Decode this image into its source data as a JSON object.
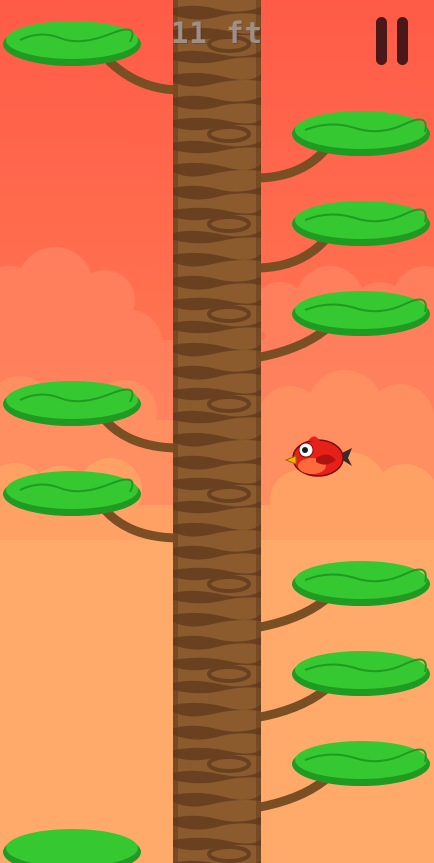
{
  "hud": {
    "score_text": "11 ft",
    "pause_icon": "pause-icon"
  },
  "colors": {
    "sky_top": "#ff5c48",
    "sky_bottom": "#ffa766",
    "cloud_back": "#ff7a5a",
    "cloud_front": "#ff9a64",
    "trunk": "#8a5a2c",
    "trunk_stripe": "#6b4220",
    "foliage": "#35c831",
    "foliage_dark": "#1f9a22",
    "branch": "#7b4f24",
    "bird_body": "#e8201a",
    "bird_beak": "#ffb400",
    "pause": "#4a1818"
  },
  "scene": {
    "branch_sides": [
      "left",
      "right",
      "right",
      "right",
      "left",
      "left",
      "right",
      "right",
      "right",
      "left"
    ],
    "player": "red-bird"
  }
}
